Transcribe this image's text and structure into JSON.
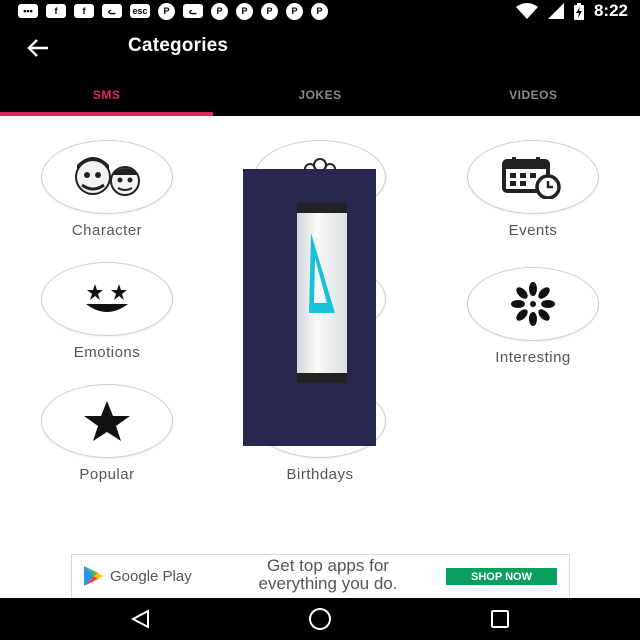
{
  "status_bar": {
    "time": "8:22",
    "left_icons": [
      "chat-icon",
      "facebook-icon",
      "facebook-icon",
      "cat-icon",
      "esc-icon",
      "pinterest-icon",
      "cat-icon",
      "pinterest-icon",
      "pinterest-icon",
      "pinterest-icon",
      "pinterest-icon",
      "pinterest-icon"
    ],
    "esc_label": "esc"
  },
  "app_bar": {
    "title": "Categories"
  },
  "tabs": [
    {
      "label": "SMS",
      "active": true
    },
    {
      "label": "JOKES",
      "active": false
    },
    {
      "label": "VIDEOS",
      "active": false
    }
  ],
  "categories": [
    {
      "label": "Character",
      "icon": "cartoon-characters-icon"
    },
    {
      "label": "",
      "icon": "flowers-icon"
    },
    {
      "label": "Events",
      "icon": "calendar-clock-icon"
    },
    {
      "label": "Emotions",
      "icon": "smiley-stars-icon"
    },
    {
      "label": "",
      "icon": "unknown-icon"
    },
    {
      "label": "Interesting",
      "icon": "flower-icon"
    },
    {
      "label": "Popular",
      "icon": "star-icon"
    },
    {
      "label": "Birthdays",
      "icon": "birthday-icon"
    }
  ],
  "ad": {
    "store": "Google Play",
    "text": "Get top apps for everything you do.",
    "button": "SHOP NOW",
    "accent": "#0a9f5c"
  },
  "colors": {
    "accent": "#e0245e",
    "bars": "#000000"
  }
}
